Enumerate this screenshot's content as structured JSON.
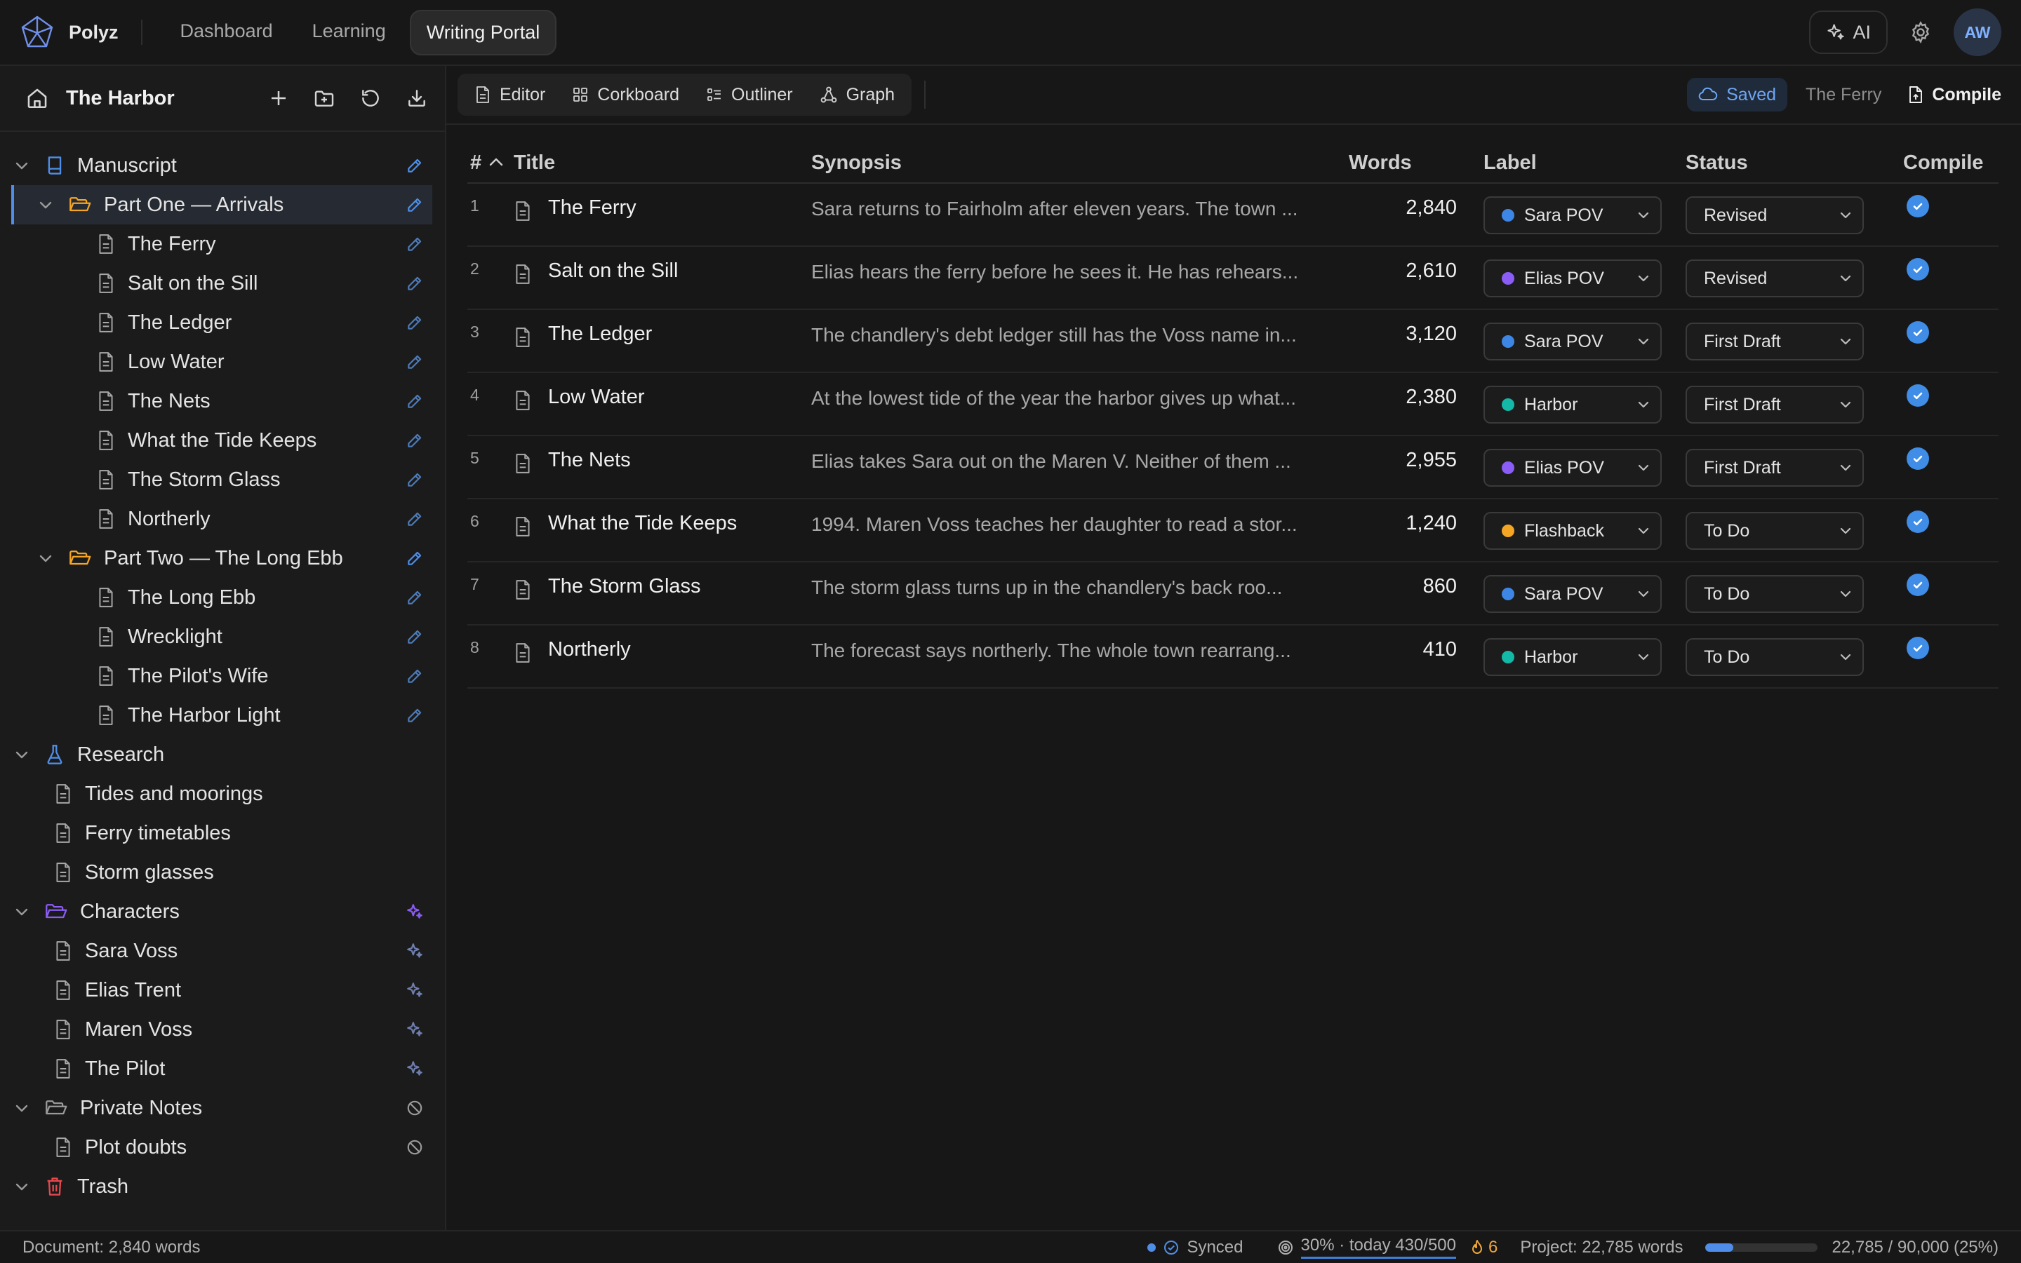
{
  "app": {
    "brand": "Polyz"
  },
  "nav": {
    "tabs": [
      {
        "label": "Dashboard"
      },
      {
        "label": "Learning"
      },
      {
        "label": "Writing Portal"
      }
    ]
  },
  "topbar": {
    "ai_label": "AI",
    "avatar_initials": "AW"
  },
  "sidebar": {
    "project_title": "The Harbor",
    "icons": [
      "home-icon",
      "plus-icon",
      "folder-plus-icon",
      "history-icon",
      "download-icon"
    ],
    "items": [
      {
        "label": "Manuscript",
        "icon": "book-icon",
        "depth": 0,
        "caret": true,
        "tail": "pencil"
      },
      {
        "label": "Part One — Arrivals",
        "icon": "folder-open-icon",
        "depth": 1,
        "caret": true,
        "tail": "pencil",
        "selected": true
      },
      {
        "label": "The Ferry",
        "icon": "document-icon",
        "depth": 2,
        "tail": "pencil-muted"
      },
      {
        "label": "Salt on the Sill",
        "icon": "document-icon",
        "depth": 2,
        "tail": "pencil-muted"
      },
      {
        "label": "The Ledger",
        "icon": "document-icon",
        "depth": 2,
        "tail": "pencil-muted"
      },
      {
        "label": "Low Water",
        "icon": "document-icon",
        "depth": 2,
        "tail": "pencil-muted"
      },
      {
        "label": "The Nets",
        "icon": "document-icon",
        "depth": 2,
        "tail": "pencil-muted"
      },
      {
        "label": "What the Tide Keeps",
        "icon": "document-icon",
        "depth": 2,
        "tail": "pencil-muted"
      },
      {
        "label": "The Storm Glass",
        "icon": "document-icon",
        "depth": 2,
        "tail": "pencil-muted"
      },
      {
        "label": "Northerly",
        "icon": "document-icon",
        "depth": 2,
        "tail": "pencil-muted"
      },
      {
        "label": "Part Two — The Long Ebb",
        "icon": "folder-open-icon",
        "depth": 1,
        "caret": true,
        "tail": "pencil"
      },
      {
        "label": "The Long Ebb",
        "icon": "document-icon",
        "depth": 2,
        "tail": "pencil-muted"
      },
      {
        "label": "Wrecklight",
        "icon": "document-icon",
        "depth": 2,
        "tail": "pencil-muted"
      },
      {
        "label": "The Pilot's Wife",
        "icon": "document-icon",
        "depth": 2,
        "tail": "pencil-muted"
      },
      {
        "label": "The Harbor Light",
        "icon": "document-icon",
        "depth": 2,
        "tail": "pencil-muted"
      },
      {
        "label": "Research",
        "icon": "flask-icon",
        "depth": 0,
        "caret": true
      },
      {
        "label": "Tides and moorings",
        "icon": "document-icon",
        "depth": 1
      },
      {
        "label": "Ferry timetables",
        "icon": "document-icon",
        "depth": 1
      },
      {
        "label": "Storm glasses",
        "icon": "document-icon",
        "depth": 1
      },
      {
        "label": "Characters",
        "icon": "folder-purple-icon",
        "depth": 0,
        "caret": true,
        "tail": "sparkle"
      },
      {
        "label": "Sara Voss",
        "icon": "document-icon",
        "depth": 1,
        "tail": "sparkle-muted"
      },
      {
        "label": "Elias Trent",
        "icon": "document-icon",
        "depth": 1,
        "tail": "sparkle-muted"
      },
      {
        "label": "Maren Voss",
        "icon": "document-icon",
        "depth": 1,
        "tail": "sparkle-muted"
      },
      {
        "label": "The Pilot",
        "icon": "document-icon",
        "depth": 1,
        "tail": "sparkle-muted"
      },
      {
        "label": "Private Notes",
        "icon": "folder-gray-icon",
        "depth": 0,
        "caret": true,
        "tail": "ban"
      },
      {
        "label": "Plot doubts",
        "icon": "document-icon",
        "depth": 1,
        "tail": "ban"
      },
      {
        "label": "Trash",
        "icon": "trash-icon",
        "depth": 0,
        "caret": true
      }
    ]
  },
  "toolbar": {
    "views": [
      {
        "label": "Editor",
        "icon": "document-icon"
      },
      {
        "label": "Corkboard",
        "icon": "grid-icon"
      },
      {
        "label": "Outliner",
        "icon": "list-icon"
      },
      {
        "label": "Graph",
        "icon": "graph-icon"
      }
    ],
    "saved": "Saved",
    "current_doc": "The Ferry",
    "compile": "Compile"
  },
  "table": {
    "headers": {
      "num": "#",
      "title": "Title",
      "synopsis": "Synopsis",
      "words": "Words",
      "label": "Label",
      "status": "Status",
      "compile": "Compile"
    },
    "rows": [
      {
        "num": "1",
        "title": "The Ferry",
        "synopsis": "Sara returns to Fairholm after eleven years. The town ...",
        "words": "2,840",
        "label": "Sara POV",
        "label_color": "#3d86e6",
        "status": "Revised",
        "compile": true
      },
      {
        "num": "2",
        "title": "Salt on the Sill",
        "synopsis": "Elias hears the ferry before he sees it. He has rehears...",
        "words": "2,610",
        "label": "Elias POV",
        "label_color": "#8b5cf6",
        "status": "Revised",
        "compile": true
      },
      {
        "num": "3",
        "title": "The Ledger",
        "synopsis": "The chandlery's debt ledger still has the Voss name in...",
        "words": "3,120",
        "label": "Sara POV",
        "label_color": "#3d86e6",
        "status": "First Draft",
        "compile": true
      },
      {
        "num": "4",
        "title": "Low Water",
        "synopsis": "At the lowest tide of the year the harbor gives up what...",
        "words": "2,380",
        "label": "Harbor",
        "label_color": "#14b8a6",
        "status": "First Draft",
        "compile": true
      },
      {
        "num": "5",
        "title": "The Nets",
        "synopsis": "Elias takes Sara out on the Maren V. Neither of them ...",
        "words": "2,955",
        "label": "Elias POV",
        "label_color": "#8b5cf6",
        "status": "First Draft",
        "compile": true
      },
      {
        "num": "6",
        "title": "What the Tide Keeps",
        "synopsis": "1994. Maren Voss teaches her daughter to read a stor...",
        "words": "1,240",
        "label": "Flashback",
        "label_color": "#f5a524",
        "status": "To Do",
        "compile": true
      },
      {
        "num": "7",
        "title": "The Storm Glass",
        "synopsis": "The storm glass turns up in the chandlery's back roo...",
        "words": "860",
        "label": "Sara POV",
        "label_color": "#3d86e6",
        "status": "To Do",
        "compile": true
      },
      {
        "num": "8",
        "title": "Northerly",
        "synopsis": "The forecast says northerly. The whole town rearrang...",
        "words": "410",
        "label": "Harbor",
        "label_color": "#14b8a6",
        "status": "To Do",
        "compile": true
      }
    ]
  },
  "statusbar": {
    "document": "Document: 2,840 words",
    "synced": "Synced",
    "goal": "30% · today 430/500",
    "streak": "6",
    "project": "Project: 22,785 words",
    "progress_fraction": 0.25,
    "progress_text": "22,785 / 90,000 (25%)"
  },
  "colors": {
    "accent": "#4f8ee8",
    "folder": "#f5a524",
    "characters": "#8b5cf6",
    "trash": "#e5484d",
    "background": "#161616"
  }
}
